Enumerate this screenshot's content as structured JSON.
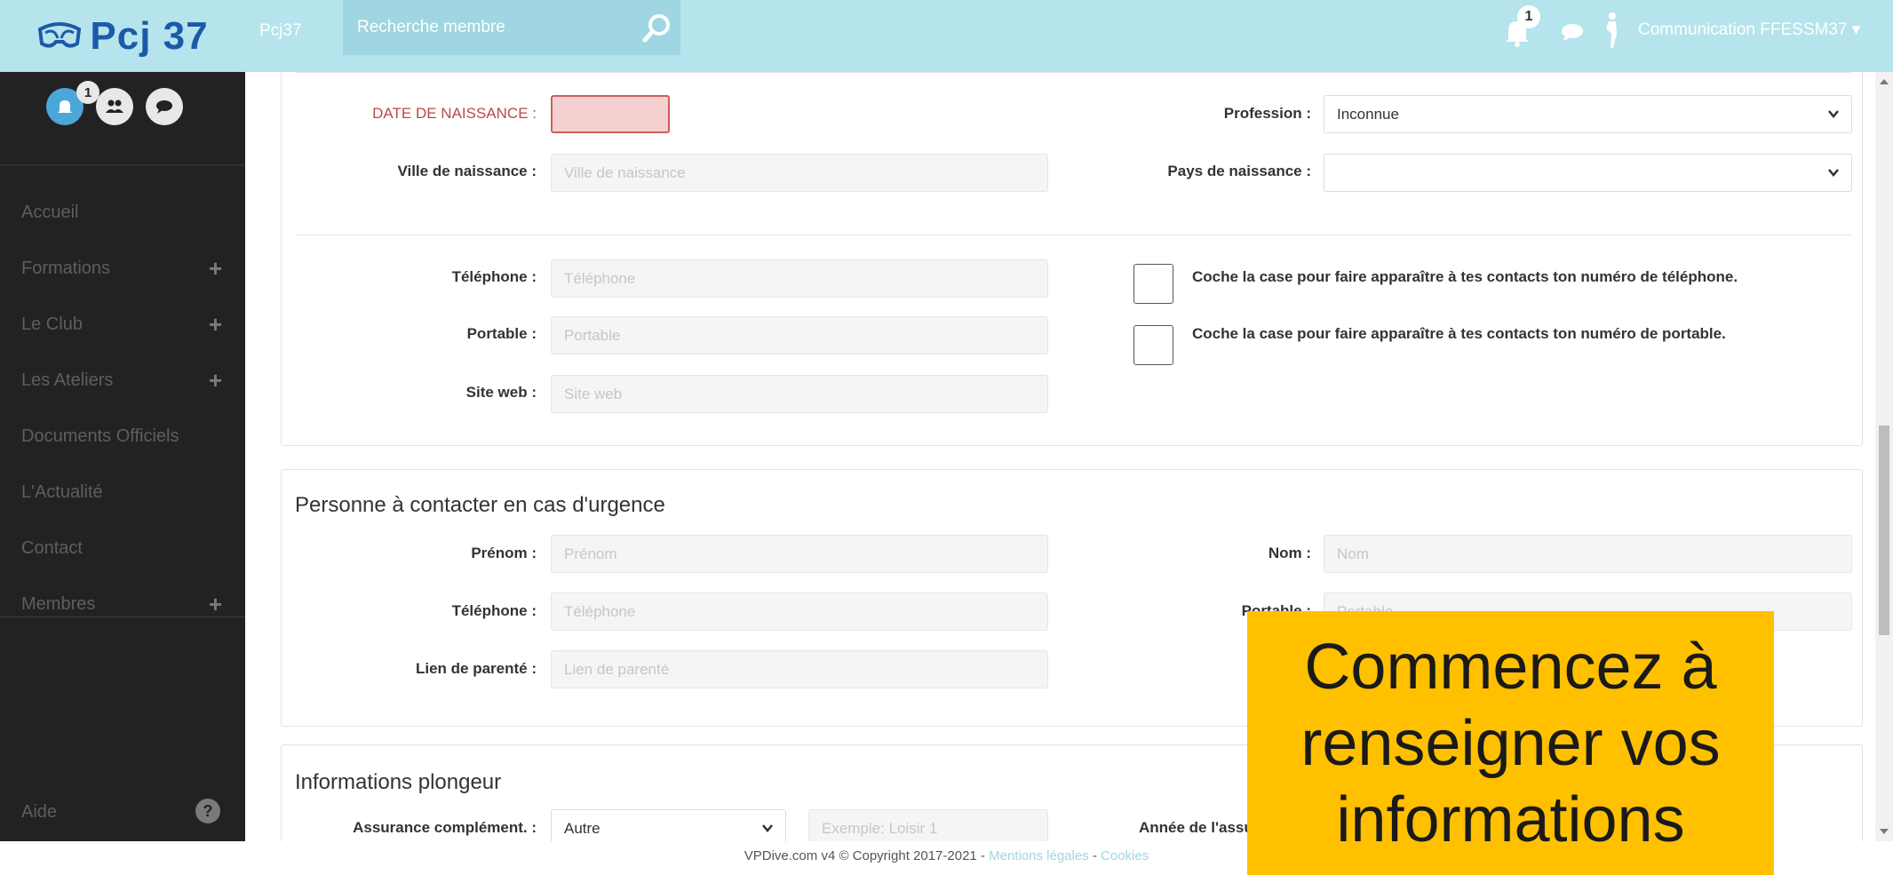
{
  "topbar": {
    "logo_text": "Pcj 37",
    "club_label": "Pcj37",
    "search_placeholder": "Recherche membre",
    "notification_count": "1",
    "user_name": "Communication FFESSM37 ▾"
  },
  "sidebar": {
    "notification_count": "1",
    "items": [
      {
        "label": "Accueil",
        "has_plus": false
      },
      {
        "label": "Formations",
        "has_plus": true
      },
      {
        "label": "Le Club",
        "has_plus": true
      },
      {
        "label": "Les Ateliers",
        "has_plus": true
      },
      {
        "label": "Documents Officiels",
        "has_plus": false
      },
      {
        "label": "L'Actualité",
        "has_plus": false
      },
      {
        "label": "Contact",
        "has_plus": false
      },
      {
        "label": "Membres",
        "has_plus": true
      }
    ],
    "help_label": "Aide"
  },
  "personal": {
    "birthdate_label": "DATE DE NAISSANCE :",
    "birthdate_value": "",
    "birthplace_label": "Ville de naissance :",
    "birthplace_placeholder": "Ville de naissance",
    "profession_label": "Profession :",
    "profession_value": "Inconnue",
    "birthcountry_label": "Pays de naissance :",
    "birthcountry_value": "",
    "phone_label": "Téléphone :",
    "phone_placeholder": "Téléphone",
    "mobile_label": "Portable :",
    "mobile_placeholder": "Portable",
    "website_label": "Site web :",
    "website_placeholder": "Site web",
    "phone_share_text": "Coche la case pour faire apparaître à tes contacts ton numéro de téléphone.",
    "mobile_share_text": "Coche la case pour faire apparaître à tes contacts ton numéro de portable."
  },
  "emergency": {
    "title": "Personne à contacter en cas d'urgence",
    "firstname_label": "Prénom :",
    "firstname_placeholder": "Prénom",
    "lastname_label": "Nom :",
    "lastname_placeholder": "Nom",
    "phone_label": "Téléphone :",
    "phone_placeholder": "Téléphone",
    "mobile_label": "Portable :",
    "mobile_placeholder": "Portable",
    "relation_label": "Lien de parenté :",
    "relation_placeholder": "Lien de parenté"
  },
  "diver": {
    "title": "Informations plongeur",
    "insurance_label": "Assurance complément. :",
    "insurance_value": "Autre",
    "insurance_detail_placeholder": "Exemple: Loisir 1",
    "insurance_year_label": "Année de l'assura"
  },
  "footer": {
    "text": "VPDive.com v4 © Copyright 2017-2021 - ",
    "legal_link": "Mentions légales",
    "separator": " - ",
    "cookies_link": "Cookies"
  },
  "callout": {
    "line1": "Commencez à",
    "line2": "renseigner vos",
    "line3": "informations"
  },
  "colors": {
    "topbar": "#b5e4ec",
    "sidebar": "#222222",
    "callout": "#ffc000",
    "error": "#b94a48"
  }
}
